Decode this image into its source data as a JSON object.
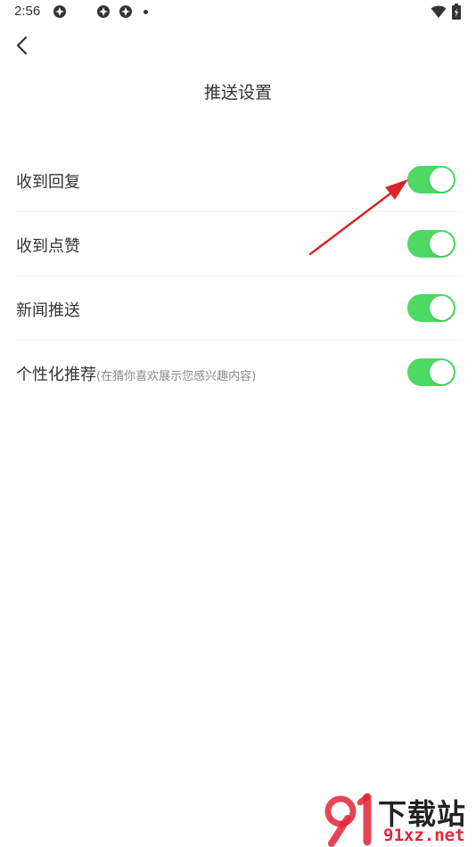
{
  "status_bar": {
    "time": "2:56",
    "left_icons": [
      "app-icon",
      "app-icon",
      "app-icon"
    ],
    "right_icons": [
      "wifi-icon",
      "battery-icon"
    ]
  },
  "header": {
    "back_icon": "chevron-left-icon",
    "title": "推送设置"
  },
  "settings": [
    {
      "label": "收到回复",
      "hint": "",
      "enabled": true
    },
    {
      "label": "收到点赞",
      "hint": "",
      "enabled": true
    },
    {
      "label": "新闻推送",
      "hint": "",
      "enabled": true
    },
    {
      "label": "个性化推荐",
      "hint": "(在猜你喜欢展示您感兴趣内容)",
      "enabled": true
    }
  ],
  "colors": {
    "toggle_on": "#4cd964",
    "annotation_arrow": "#d9262b",
    "watermark_red": "#e0263a"
  },
  "watermark": {
    "cn": "下载站",
    "en": "91xz.net"
  }
}
